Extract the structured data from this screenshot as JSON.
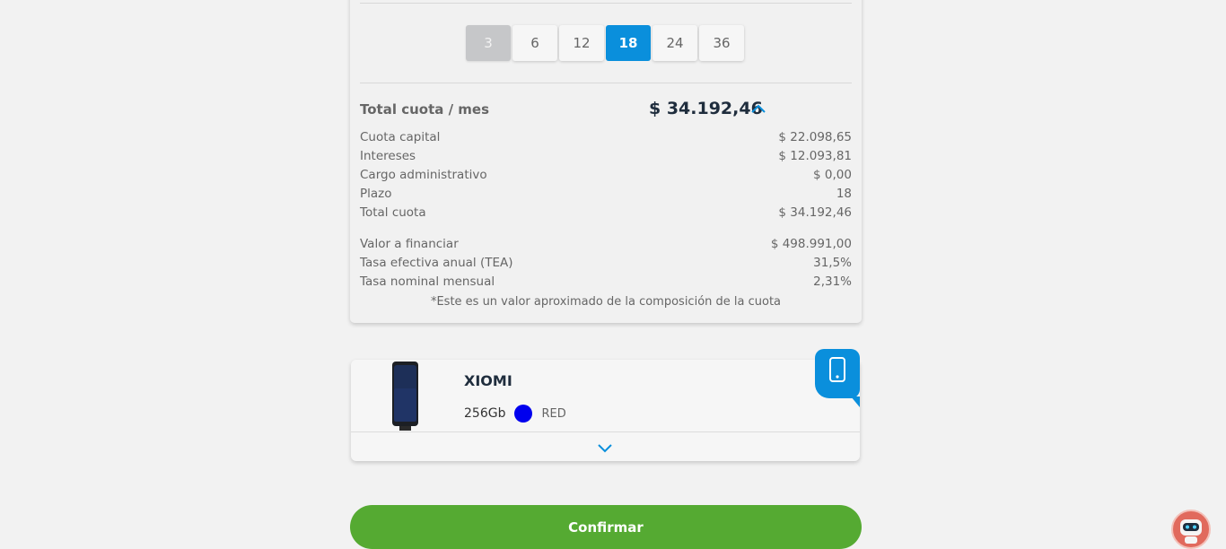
{
  "terms": {
    "options": [
      "3",
      "6",
      "12",
      "18",
      "24",
      "36"
    ],
    "disabled_index": 0,
    "selected_index": 3
  },
  "summary": {
    "total_label": "Total cuota / mes",
    "total_value": "$ 34.192,46"
  },
  "breakdown": {
    "rows": [
      {
        "label": "Cuota capital",
        "value": "$ 22.098,65"
      },
      {
        "label": "Intereses",
        "value": "$ 12.093,81"
      },
      {
        "label": "Cargo administrativo",
        "value": "$ 0,00"
      },
      {
        "label": "Plazo",
        "value": "18"
      },
      {
        "label": "Total cuota",
        "value": "$ 34.192,46"
      }
    ],
    "rows2": [
      {
        "label": "Valor a financiar",
        "value": "$ 498.991,00"
      },
      {
        "label": "Tasa efectiva anual (TEA)",
        "value": "31,5%"
      },
      {
        "label": "Tasa nominal mensual",
        "value": "2,31%"
      }
    ],
    "note": "*Este es un valor aproximado de la composición de la cuota"
  },
  "product": {
    "name": "XIOMI",
    "storage": "256Gb",
    "color_name": "RED",
    "color_hex": "#0000ee",
    "tag_icon": "smartphone-icon"
  },
  "actions": {
    "confirm_label": "Confirmar"
  },
  "colors": {
    "accent_blue": "#0a8fdc",
    "confirm_green": "#55aa32",
    "chatbot": "#e16a5d"
  }
}
